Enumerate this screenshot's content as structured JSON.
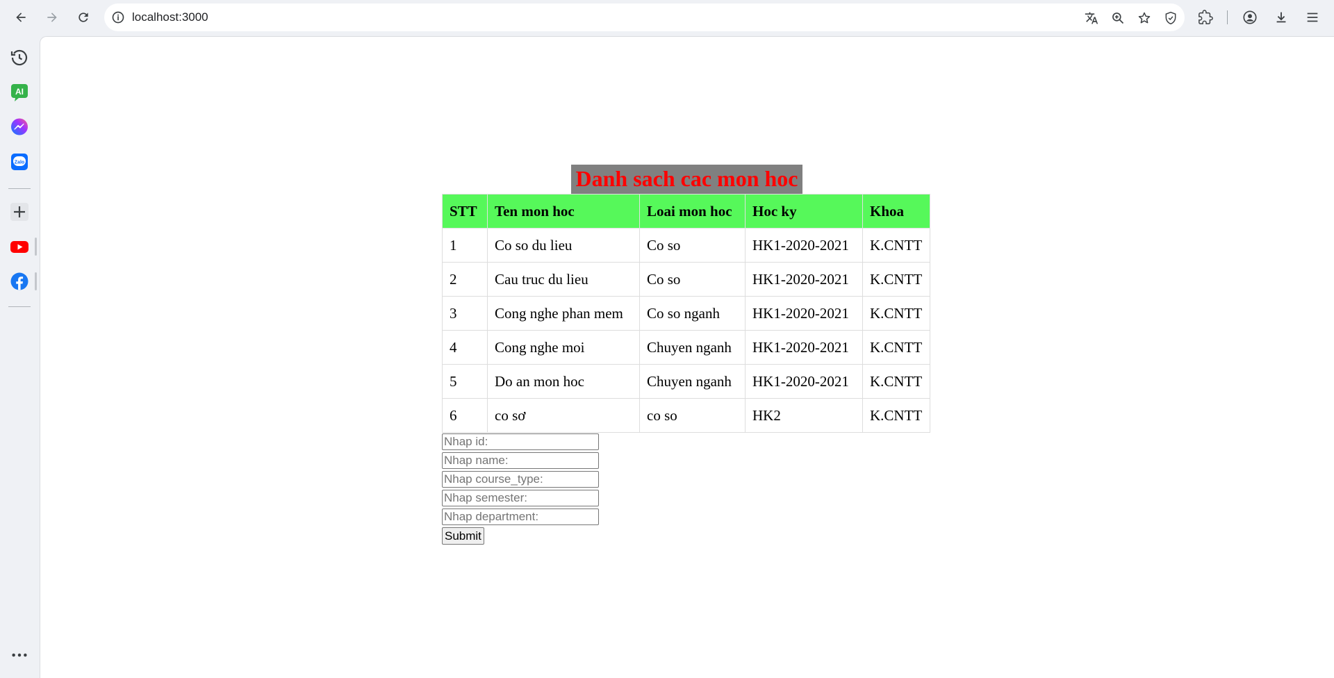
{
  "browser": {
    "url": "localhost:3000",
    "icons": [
      "back-icon",
      "forward-icon",
      "reload-icon",
      "site-info-icon",
      "translate-icon",
      "zoom-icon",
      "bookmark-star-icon",
      "shield-icon",
      "extensions-icon",
      "profile-icon",
      "downloads-icon",
      "menu-icon"
    ]
  },
  "sidebar": {
    "items": [
      "history-icon",
      "ai-chat-icon",
      "messenger-icon",
      "zalo-icon",
      "add-icon",
      "youtube-icon",
      "facebook-icon",
      "more-icon"
    ],
    "zalo_text": "Zalo",
    "ai_text": "AI"
  },
  "page": {
    "title": "Danh sach cac mon hoc",
    "title_color": "#ff0000",
    "title_bg": "#808080",
    "header_bg": "#56f85a",
    "columns": [
      "STT",
      "Ten mon hoc",
      "Loai mon hoc",
      "Hoc ky",
      "Khoa"
    ],
    "rows": [
      [
        "1",
        "Co so du lieu",
        "Co so",
        "HK1-2020-2021",
        "K.CNTT"
      ],
      [
        "2",
        "Cau truc du lieu",
        "Co so",
        "HK1-2020-2021",
        "K.CNTT"
      ],
      [
        "3",
        "Cong nghe phan mem",
        "Co so nganh",
        "HK1-2020-2021",
        "K.CNTT"
      ],
      [
        "4",
        "Cong nghe moi",
        "Chuyen nganh",
        "HK1-2020-2021",
        "K.CNTT"
      ],
      [
        "5",
        "Do an mon hoc",
        "Chuyen nganh",
        "HK1-2020-2021",
        "K.CNTT"
      ],
      [
        "6",
        "co sơ",
        "co so",
        "HK2",
        "K.CNTT"
      ]
    ],
    "form": {
      "id_placeholder": "Nhap id:",
      "name_placeholder": "Nhap name:",
      "course_type_placeholder": "Nhap course_type:",
      "semester_placeholder": "Nhap semester:",
      "department_placeholder": "Nhap department:",
      "submit_label": "Submit"
    }
  }
}
